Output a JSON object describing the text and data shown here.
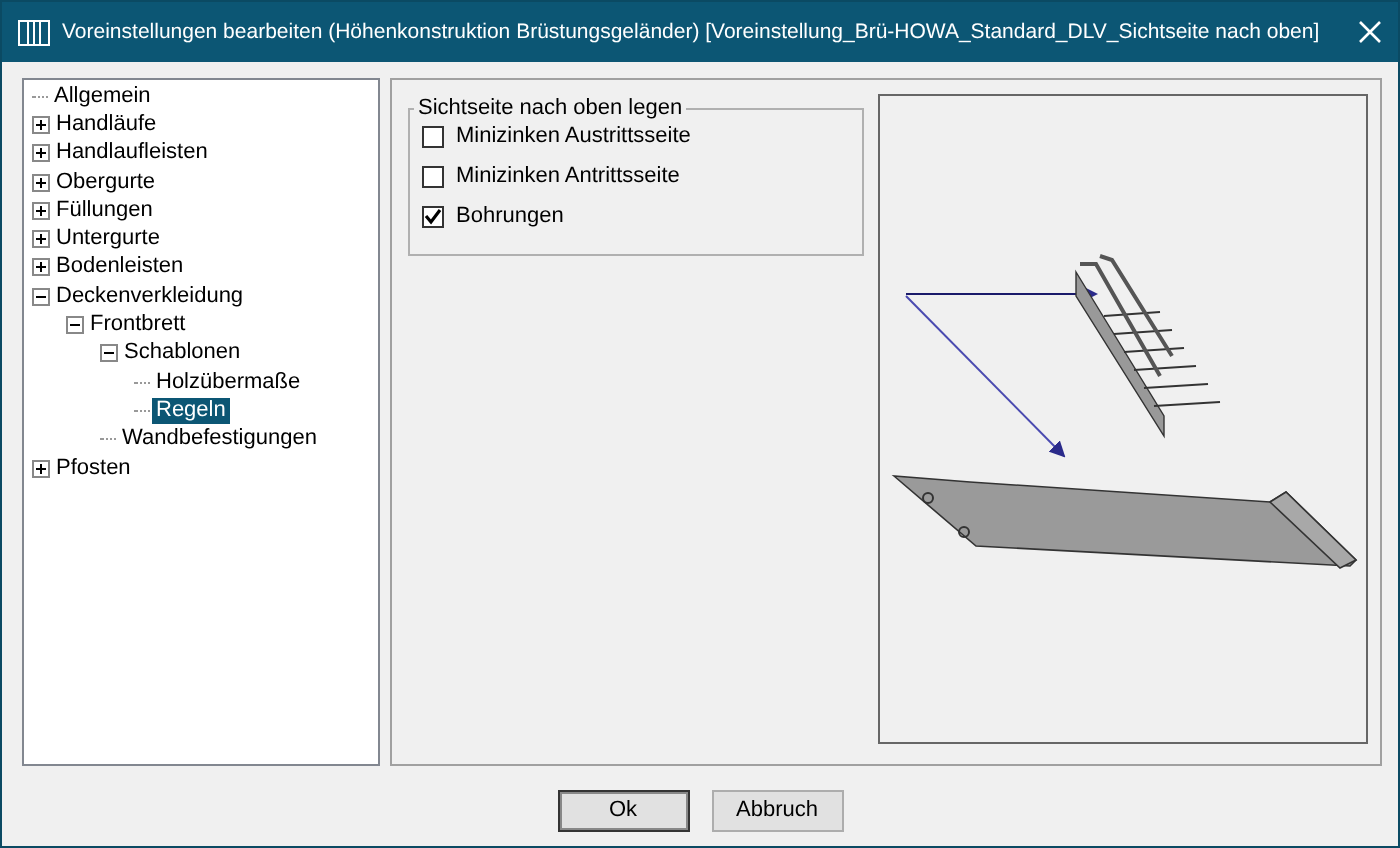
{
  "window": {
    "title": "Voreinstellungen bearbeiten (Höhenkonstruktion Brüstungsgeländer) [Voreinstellung_Brü-HOWA_Standard_DLV_Sichtseite nach oben]"
  },
  "tree": [
    {
      "label": "Allgemein",
      "selected": false
    },
    {
      "label": "Handläufe",
      "selected": false,
      "expanded": false
    },
    {
      "label": "Handlaufleisten",
      "selected": false,
      "expanded": false
    },
    {
      "label": "Obergurte",
      "selected": false,
      "expanded": false
    },
    {
      "label": "Füllungen",
      "selected": false,
      "expanded": false
    },
    {
      "label": "Untergurte",
      "selected": false,
      "expanded": false
    },
    {
      "label": "Bodenleisten",
      "selected": false,
      "expanded": false
    },
    {
      "label": "Deckenverkleidung",
      "selected": false,
      "expanded": true,
      "children": [
        {
          "label": "Frontbrett",
          "selected": false,
          "expanded": true,
          "children": [
            {
              "label": "Schablonen",
              "selected": false,
              "expanded": true,
              "children": [
                {
                  "label": "Holzübermaße",
                  "selected": false
                },
                {
                  "label": "Regeln",
                  "selected": true
                }
              ]
            },
            {
              "label": "Wandbefestigungen",
              "selected": false
            }
          ]
        }
      ]
    },
    {
      "label": "Pfosten",
      "selected": false,
      "expanded": false
    }
  ],
  "group": {
    "title": "Sichtseite nach oben legen",
    "options": [
      {
        "label": "Minizinken Austrittsseite",
        "checked": false
      },
      {
        "label": "Minizinken Antrittsseite",
        "checked": false
      },
      {
        "label": "Bohrungen",
        "checked": true
      }
    ]
  },
  "buttons": [
    "Ok",
    "Abbruch"
  ]
}
